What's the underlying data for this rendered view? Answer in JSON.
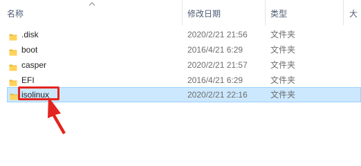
{
  "header": {
    "name_label": "名称",
    "date_label": "修改日期",
    "type_label": "类型",
    "size_label": "大"
  },
  "files": [
    {
      "name": ".disk",
      "date": "2020/2/21 21:56",
      "type": "文件夹",
      "selected": false
    },
    {
      "name": "boot",
      "date": "2016/4/21 6:29",
      "type": "文件夹",
      "selected": false
    },
    {
      "name": "casper",
      "date": "2020/2/21 21:57",
      "type": "文件夹",
      "selected": false
    },
    {
      "name": "EFI",
      "date": "2016/4/21 6:29",
      "type": "文件夹",
      "selected": false
    },
    {
      "name": "isolinux",
      "date": "2020/2/21 22:16",
      "type": "文件夹",
      "selected": true
    }
  ],
  "icons": {
    "folder": "folder-icon",
    "sort": "sort-ascending-icon"
  },
  "colors": {
    "selection_bg": "#cce8ff",
    "selection_border": "#99d1ff",
    "annotation": "#e4241e",
    "folder": "#ffd35b"
  }
}
